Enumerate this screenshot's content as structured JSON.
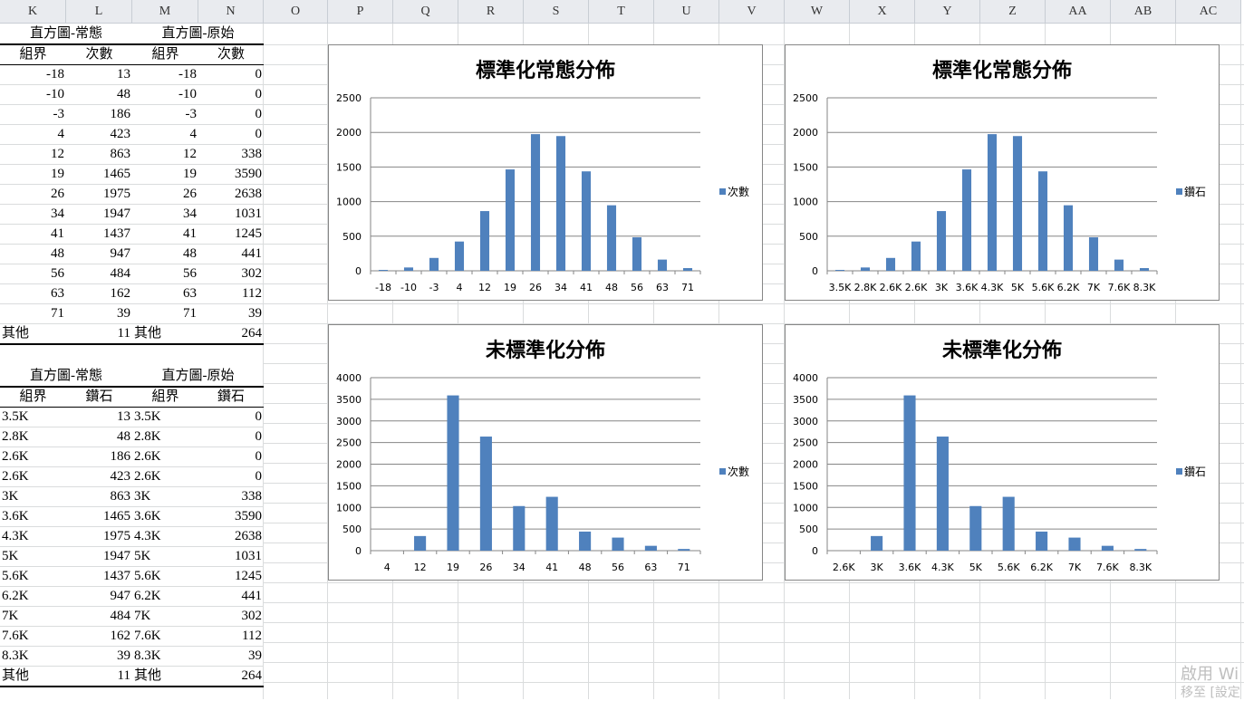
{
  "columns": [
    "K",
    "L",
    "M",
    "N",
    "O",
    "P",
    "Q",
    "R",
    "S",
    "T",
    "U",
    "V",
    "W",
    "X",
    "Y",
    "Z",
    "AA",
    "AB",
    "AC"
  ],
  "table1": {
    "title_left": "直方圖-常態",
    "title_right": "直方圖-原始",
    "headers": [
      "組界",
      "次數",
      "組界",
      "次數"
    ],
    "rows": [
      [
        "-18",
        "13",
        "-18",
        "0"
      ],
      [
        "-10",
        "48",
        "-10",
        "0"
      ],
      [
        "-3",
        "186",
        "-3",
        "0"
      ],
      [
        "4",
        "423",
        "4",
        "0"
      ],
      [
        "12",
        "863",
        "12",
        "338"
      ],
      [
        "19",
        "1465",
        "19",
        "3590"
      ],
      [
        "26",
        "1975",
        "26",
        "2638"
      ],
      [
        "34",
        "1947",
        "34",
        "1031"
      ],
      [
        "41",
        "1437",
        "41",
        "1245"
      ],
      [
        "48",
        "947",
        "48",
        "441"
      ],
      [
        "56",
        "484",
        "56",
        "302"
      ],
      [
        "63",
        "162",
        "63",
        "112"
      ],
      [
        "71",
        "39",
        "71",
        "39"
      ],
      [
        "其他",
        "11",
        "其他",
        "264"
      ]
    ]
  },
  "table2": {
    "title_left": "直方圖-常態",
    "title_right": "直方圖-原始",
    "headers": [
      "組界",
      "鑽石",
      "組界",
      "鑽石"
    ],
    "rows": [
      [
        "3.5K",
        "13",
        "3.5K",
        "0"
      ],
      [
        "2.8K",
        "48",
        "2.8K",
        "0"
      ],
      [
        "2.6K",
        "186",
        "2.6K",
        "0"
      ],
      [
        "2.6K",
        "423",
        "2.6K",
        "0"
      ],
      [
        "3K",
        "863",
        "3K",
        "338"
      ],
      [
        "3.6K",
        "1465",
        "3.6K",
        "3590"
      ],
      [
        "4.3K",
        "1975",
        "4.3K",
        "2638"
      ],
      [
        "5K",
        "1947",
        "5K",
        "1031"
      ],
      [
        "5.6K",
        "1437",
        "5.6K",
        "1245"
      ],
      [
        "6.2K",
        "947",
        "6.2K",
        "441"
      ],
      [
        "7K",
        "484",
        "7K",
        "302"
      ],
      [
        "7.6K",
        "162",
        "7.6K",
        "112"
      ],
      [
        "8.3K",
        "39",
        "8.3K",
        "39"
      ],
      [
        "其他",
        "11",
        "其他",
        "264"
      ]
    ]
  },
  "bar_color": "#4f81bd",
  "chart_data": [
    {
      "type": "bar",
      "title": "標準化常態分佈",
      "categories": [
        "-18",
        "-10",
        "-3",
        "4",
        "12",
        "19",
        "26",
        "34",
        "41",
        "48",
        "56",
        "63",
        "71"
      ],
      "series": [
        {
          "name": "次數",
          "values": [
            13,
            48,
            186,
            423,
            863,
            1465,
            1975,
            1947,
            1437,
            947,
            484,
            162,
            39
          ]
        }
      ],
      "ylim": [
        0,
        2500
      ],
      "yticks": [
        "0",
        "500",
        "1000",
        "1500",
        "2000",
        "2500"
      ],
      "legend": "right",
      "grid": true
    },
    {
      "type": "bar",
      "title": "標準化常態分佈",
      "categories": [
        "3.5K",
        "2.8K",
        "2.6K",
        "2.6K",
        "3K",
        "3.6K",
        "4.3K",
        "5K",
        "5.6K",
        "6.2K",
        "7K",
        "7.6K",
        "8.3K"
      ],
      "series": [
        {
          "name": "鑽石",
          "values": [
            13,
            48,
            186,
            423,
            863,
            1465,
            1975,
            1947,
            1437,
            947,
            484,
            162,
            39
          ]
        }
      ],
      "ylim": [
        0,
        2500
      ],
      "yticks": [
        "0",
        "500",
        "1000",
        "1500",
        "2000",
        "2500"
      ],
      "legend": "right",
      "grid": true
    },
    {
      "type": "bar",
      "title": "未標準化分佈",
      "categories": [
        "4",
        "12",
        "19",
        "26",
        "34",
        "41",
        "48",
        "56",
        "63",
        "71"
      ],
      "series": [
        {
          "name": "次數",
          "values": [
            0,
            338,
            3590,
            2638,
            1031,
            1245,
            441,
            302,
            112,
            39
          ]
        }
      ],
      "ylim": [
        0,
        4000
      ],
      "yticks": [
        "0",
        "500",
        "1000",
        "1500",
        "2000",
        "2500",
        "3000",
        "3500",
        "4000"
      ],
      "legend": "right",
      "grid": true
    },
    {
      "type": "bar",
      "title": "未標準化分佈",
      "categories": [
        "2.6K",
        "3K",
        "3.6K",
        "4.3K",
        "5K",
        "5.6K",
        "6.2K",
        "7K",
        "7.6K",
        "8.3K"
      ],
      "series": [
        {
          "name": "鑽石",
          "values": [
            0,
            338,
            3590,
            2638,
            1031,
            1245,
            441,
            302,
            112,
            39
          ]
        }
      ],
      "ylim": [
        0,
        4000
      ],
      "yticks": [
        "0",
        "500",
        "1000",
        "1500",
        "2000",
        "2500",
        "3000",
        "3500",
        "4000"
      ],
      "legend": "right",
      "grid": true
    }
  ],
  "watermark": {
    "line1": "啟用 Wi",
    "line2": "移至 [設定"
  }
}
